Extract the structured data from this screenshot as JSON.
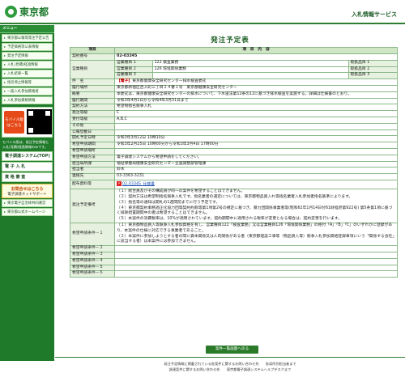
{
  "header": {
    "logo_text": "東京都",
    "service_title": "入札情報サービス"
  },
  "sidebar": {
    "menu_head": "メニュー",
    "items": [
      {
        "label": "東京都公報等発注予定公告"
      },
      {
        "label": "予定価格等公表情報"
      },
      {
        "label": "発注予定情報"
      },
      {
        "label": "入札(見積)経過情報"
      },
      {
        "label": "入札結果一覧"
      },
      {
        "label": "指名停止情報等"
      },
      {
        "label": "一般入札参加資格者"
      },
      {
        "label": "入札参加資格情報"
      }
    ],
    "mobile_button": "モバイル版はこちら",
    "mobile_note": "モバイル版は、発注予定情報と入札(見積)経過情報のみです。",
    "links_head": "",
    "links": [
      {
        "label": "電子調達システム(TOP)"
      },
      {
        "label": "電 子 入 札"
      },
      {
        "label": "資 格 審 査"
      }
    ],
    "inquiry_title": "お問合せはこちら",
    "inquiry_sub": "電子調達ネットサポート",
    "bottom_links": [
      {
        "label": "東京電子自治体共同運営"
      },
      {
        "label": "東京都公式ホームページ"
      }
    ]
  },
  "main": {
    "page_title": "発注予定表",
    "col_item": "項目",
    "col_content": "項　目　内　容",
    "rows": {
      "contract_no": {
        "label": "契約番号",
        "value": "02-03345"
      },
      "business_type": {
        "label": "営業種目",
        "items": [
          {
            "name": "営業種目 1",
            "value": "122 検査業務",
            "extra": "取扱品目 1"
          },
          {
            "name": "営業種目 2",
            "value": "126 環境関係業務",
            "extra": "取扱品目 2"
          },
          {
            "name": "営業種目 3",
            "value": "",
            "extra": "取扱品目 3"
          }
        ]
      },
      "title": {
        "label": "件　名",
        "tag": "【電子】",
        "value": "東京都健康安全研究センター排水検査委託"
      },
      "location": {
        "label": "履行場所",
        "value": "東京都新宿区百人町三丁目２４番１号　東京都健康安全研究センター"
      },
      "summary": {
        "label": "概要",
        "value": "本委託は、東京都健康安全研究センターの排水について、下水道法第12条の12に基づき排水検査を実施する。詳細は仕様書のとおり。"
      },
      "period": {
        "label": "履行期間",
        "value": "令和3年4月1日から令和4年3月31日まで"
      },
      "method": {
        "label": "契約方法",
        "value": "希望制指名競争入札"
      },
      "dept": {
        "label": "発注等級",
        "value": "C"
      },
      "grade": {
        "label": "受付等級",
        "value": "A,B,C"
      },
      "other": {
        "label": "その他",
        "value": ""
      },
      "pub": {
        "label": "公報登載日",
        "value": ""
      },
      "open": {
        "label": "開札予定日時",
        "value": "令和3年3月12日 10時10分"
      },
      "apply": {
        "label": "希望申請期間",
        "value": "令和3年2月25日 10時00分から令和3年3月4日 17時00分"
      },
      "apply_place": {
        "label": "希望申請場所",
        "value": ""
      },
      "apply_method": {
        "label": "希望申請方法",
        "value": "電子調達システムから希望申請をしてください。"
      },
      "office": {
        "label": "担当局所課",
        "value": "福祉保健局健康安全研究センター企画調整部管理課"
      },
      "person": {
        "label": "担当者",
        "value": "鈴木"
      },
      "phone": {
        "label": "連絡先",
        "value": "03-3363-3231"
      },
      "doc": {
        "label": "配布資料等",
        "value": "02-03345_仕様書"
      },
      "notes": {
        "label": "発注予定備考",
        "lines": [
          "（１）総合員及びその構成員が同一の案件を希望することはできません。",
          "（２）契約方法は希望制指名競争入札です。指名業者の選定については、東京都物品買入れ等指名業者入札参加者指名基準によります。",
          "（３）指名等の通知は開札の1週間前までに行う予定です。",
          "（４）東京都契約事務適正化協力団等契約約款等第1項第2号の規定に基づき、暴力団関係事業者等(昭和62年1月14日付61財経庶第922号) 第5条第1項に基づく排除措置期間中の者は希望することはできません。",
          "（５）本案件の消費税率は、10%が適用されています。契約期間中に適用される税率が変更となる場合は、契約変更を行います。"
        ]
      },
      "cond1": {
        "label": "希望申請条件－１",
        "lines": [
          "（１）東京都物品買入等競争入札参加資格を有し、営業種目122「検査業務」又は営業種目126「環境関係業務」の格付「A」「B」「C」のいずれかに登録があり、本案件の仕様に対応できる事業者であること。",
          "（２）本案件に参加しようとする者の間に資本関係又は人的関係がある者（東京都建設工事等（物品買入等）競争入札参加資格登録事項にいう「関係する会社」に該当する者）は本案件には参加できません。"
        ]
      },
      "cond2": {
        "label": "希望申請条件－２",
        "value": ""
      },
      "cond3": {
        "label": "希望申請条件－３",
        "value": ""
      },
      "cond4": {
        "label": "希望申請条件－４",
        "value": ""
      },
      "cond5": {
        "label": "希望申請条件－５",
        "value": ""
      },
      "cond6": {
        "label": "希望申請条件－６",
        "value": ""
      }
    },
    "back_button": "案件一覧画面へ戻る"
  },
  "footer": {
    "line1": "発注予定情報に掲載されている各案件に関するお問い合わせ先　　各局所別担当者まで",
    "line2": "調達案件に関するお問い合わせ先　　東京都電子調達システムヘルプデスクまで"
  }
}
